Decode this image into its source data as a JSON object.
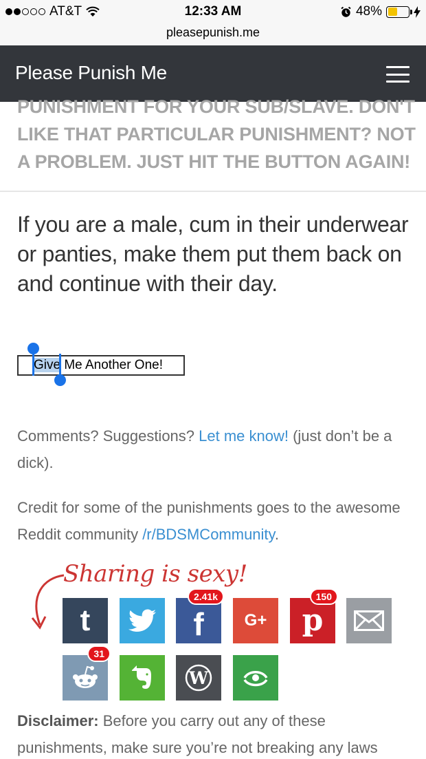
{
  "status_bar": {
    "carrier": "AT&T",
    "time": "12:33 AM",
    "battery_percent": "48%",
    "battery_level": 0.48,
    "icons": [
      "signal-dots-icon",
      "wifi-icon",
      "alarm-icon",
      "battery-icon",
      "charging-bolt-icon"
    ]
  },
  "browser": {
    "url": "pleasepunish.me"
  },
  "header": {
    "site_title": "Please Punish Me",
    "menu_icon": "hamburger-menu-icon"
  },
  "intro": {
    "text": "Punishment for your sub/slave. Don't like that particular punishment? Not a problem. Just hit the button again!"
  },
  "punishment": {
    "text": "If you are a male, cum in their underwear or panties, make them put them back on and continue with their day."
  },
  "button": {
    "selected_word": "Give",
    "rest_label": " Me Another One!"
  },
  "comments": {
    "prefix": "Comments? Suggestions? ",
    "link": "Let me know!",
    "suffix": " (just don’t be a dick)."
  },
  "credit": {
    "prefix": "Credit for some of the punishments goes to the awesome Reddit community ",
    "link": "/r/BDSMCommunity",
    "suffix": "."
  },
  "sharing": {
    "title": "Sharing is sexy!",
    "buttons": [
      {
        "name": "tumblr",
        "icon": "tumblr-icon",
        "color": "#35465c"
      },
      {
        "name": "twitter",
        "icon": "twitter-icon",
        "color": "#3aa9e0"
      },
      {
        "name": "facebook",
        "icon": "facebook-icon",
        "color": "#3b5998",
        "count": "2.41k"
      },
      {
        "name": "google-plus",
        "icon": "google-plus-icon",
        "color": "#dd4b39",
        "label": "G+"
      },
      {
        "name": "pinterest",
        "icon": "pinterest-icon",
        "color": "#cb2027",
        "count": "150"
      },
      {
        "name": "email",
        "icon": "email-icon",
        "color": "#9a9ea3"
      },
      {
        "name": "reddit",
        "icon": "reddit-icon",
        "color": "#7f9ab3",
        "count": "31"
      },
      {
        "name": "evernote",
        "icon": "evernote-icon",
        "color": "#54b335"
      },
      {
        "name": "wordpress",
        "icon": "wordpress-icon",
        "color": "#4a4d52"
      },
      {
        "name": "sharethis",
        "icon": "sharethis-icon",
        "color": "#3aa24a"
      }
    ]
  },
  "disclaimer": {
    "label": "Disclaimer:",
    "text": " Before you carry out any of these punishments, make sure you’re not breaking any laws"
  }
}
